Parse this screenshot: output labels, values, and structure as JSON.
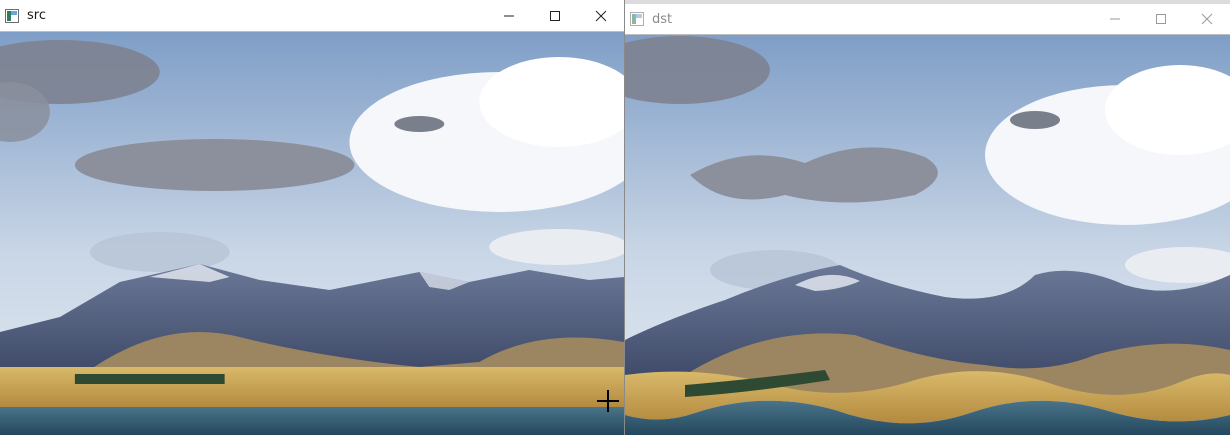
{
  "windows": {
    "src": {
      "title": "src"
    },
    "dst": {
      "title": "dst"
    }
  },
  "controls": {
    "minimize_icon": "minimize-icon",
    "maximize_icon": "maximize-icon",
    "close_icon": "close-icon"
  },
  "cursor": {
    "icon": "crosshair-cursor-icon"
  },
  "colors": {
    "sky_top": "#7f9ec7",
    "sky_bottom": "#dfe7f0",
    "mountain": "#4c5a7d",
    "hill": "#a08a63",
    "plain": "#c9a656",
    "water": "#2f5a73"
  }
}
